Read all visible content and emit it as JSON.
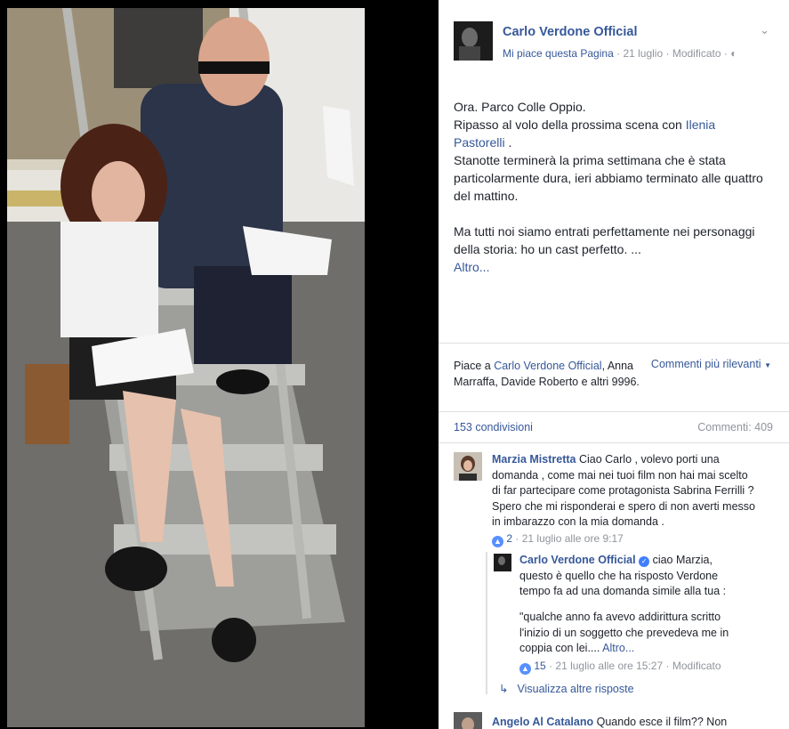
{
  "page": {
    "name": "Carlo Verdone Official",
    "like_link": "Mi piace questa Pagina",
    "date": "21 luglio",
    "edited": "Modificato"
  },
  "post": {
    "line1": "Ora. Parco Colle Oppio.",
    "line2_before": "Ripasso al volo della prossima scena con",
    "mention": "Ilenia Pastorelli",
    "line2_after": ".",
    "line3": "Stanotte terminerà la prima settimana che è stata particolarmente dura, ieri abbiamo terminato alle quattro del mattino.",
    "para2": "Ma tutti noi siamo entrati perfettamente nei personaggi della storia: ho un cast perfetto. ...",
    "more": "Altro..."
  },
  "reactions": {
    "prefix": "Piace a",
    "page_name": "Carlo Verdone Official",
    "rest": ", Anna Marraffa, Davide Roberto e altri 9996.",
    "sort": "Commenti più rilevanti",
    "shares": "153 condivisioni",
    "comments_count": "Commenti: 409"
  },
  "comments": [
    {
      "name": "Marzia Mistretta",
      "text": "Ciao Carlo , volevo porti una domanda , come mai nei tuoi film non hai mai scelto di far partecipare come protagonista Sabrina Ferrilli ? Spero che mi risponderai e spero di non averti messo in imbarazzo con la mia domanda .",
      "likes": "2",
      "date": "21 luglio alle ore 9:17"
    },
    {
      "name": "Angelo Al Catalano",
      "text": "Quando esce il film?? Non"
    }
  ],
  "reply": {
    "name": "Carlo Verdone Official",
    "text1": "ciao Marzia, questo è quello che ha risposto Verdone tempo fa ad una domanda simile alla tua :",
    "text2": "\"qualche anno fa avevo addirittura scritto l'inizio di un soggetto che prevedeva me in coppia con lei....",
    "more": "Altro...",
    "likes": "15",
    "date": "21 luglio alle ore 15:27",
    "edited": "Modificato"
  },
  "more_replies": "Visualizza altre risposte"
}
